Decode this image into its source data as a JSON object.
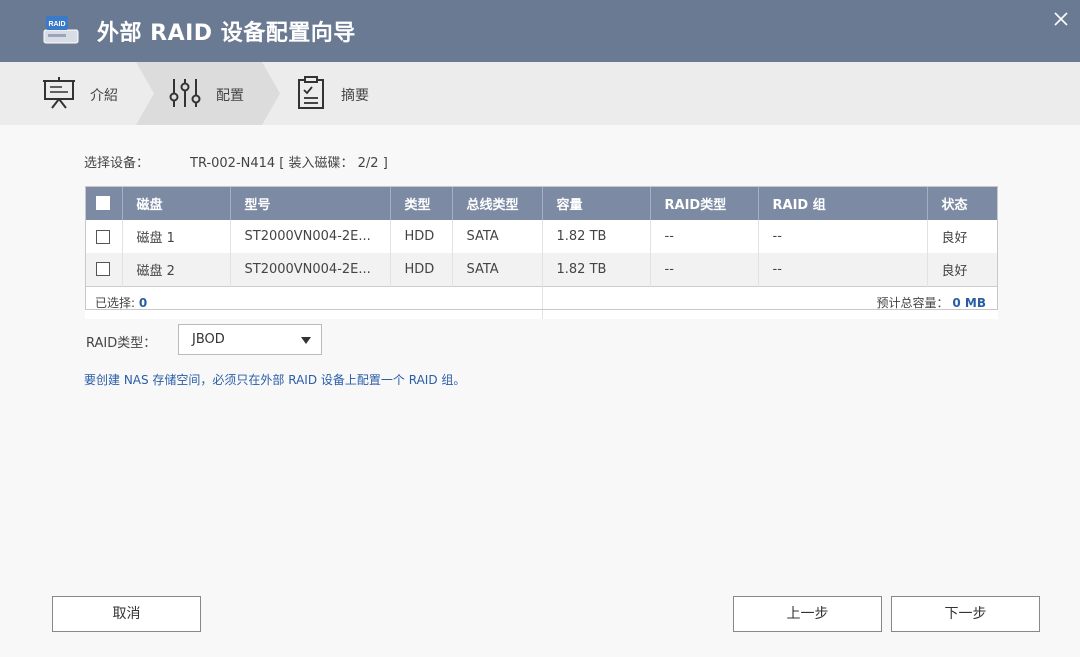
{
  "window": {
    "title": "外部 RAID 设备配置向导",
    "app_icon_text": "RAID"
  },
  "steps": [
    {
      "label": "介紹",
      "icon": "presentation-icon"
    },
    {
      "label": "配置",
      "icon": "sliders-icon"
    },
    {
      "label": "摘要",
      "icon": "clipboard-icon"
    }
  ],
  "device": {
    "label": "选择设备：",
    "value": "TR-002-N414 [ 装入磁碟： 2/2 ]"
  },
  "table": {
    "headers": [
      "磁盘",
      "型号",
      "类型",
      "总线类型",
      "容量",
      "RAID类型",
      "RAID 组",
      "状态"
    ],
    "rows": [
      {
        "disk": "磁盘 1",
        "model": "ST2000VN004-2E...",
        "type": "HDD",
        "bus": "SATA",
        "capacity": "1.82 TB",
        "raid_type": "--",
        "raid_group": "--",
        "status": "良好"
      },
      {
        "disk": "磁盘 2",
        "model": "ST2000VN004-2E...",
        "type": "HDD",
        "bus": "SATA",
        "capacity": "1.82 TB",
        "raid_type": "--",
        "raid_group": "--",
        "status": "良好"
      }
    ],
    "selected_label": "已选择: ",
    "selected_count": "0",
    "estimate_label": "预计总容量： ",
    "estimate_value": "0 MB"
  },
  "raid": {
    "label": "RAID类型：",
    "selected": "JBOD"
  },
  "hint": "要创建 NAS 存储空间，必须只在外部 RAID 设备上配置一个 RAID 组。",
  "buttons": {
    "cancel": "取消",
    "prev": "上一步",
    "next": "下一步"
  },
  "colors": {
    "titlebar": "#6b7a93",
    "table_header": "#7c8aa3",
    "accent_blue": "#2a5da8"
  }
}
